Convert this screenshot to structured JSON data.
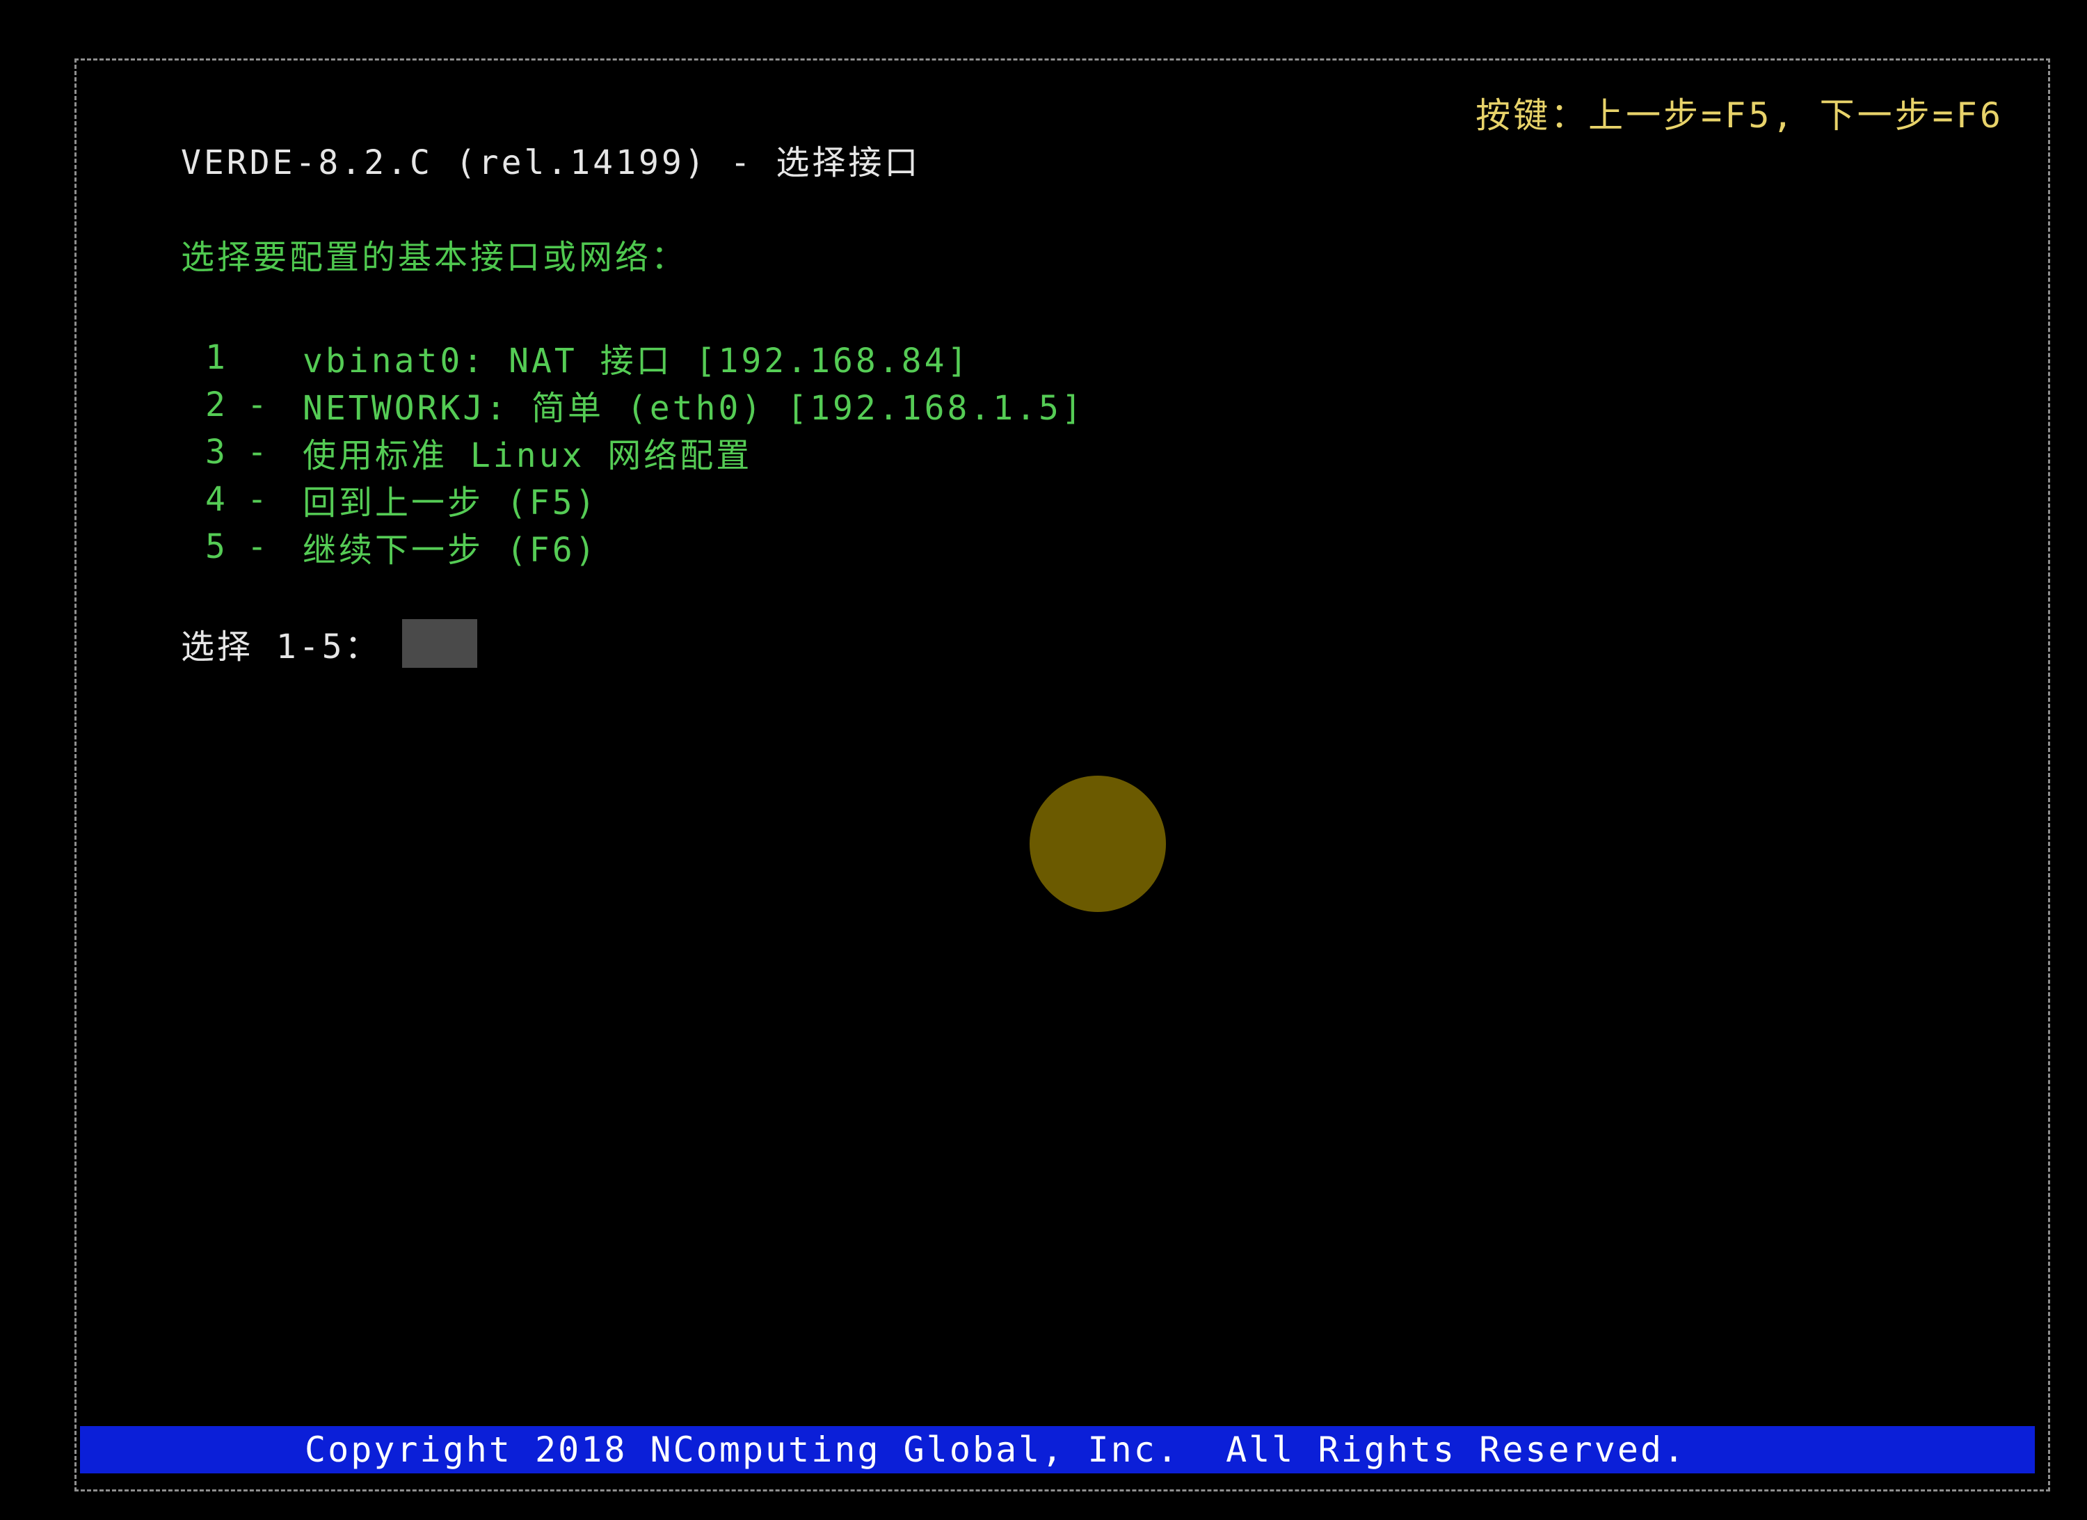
{
  "window": {
    "title": "VERDE-8.2.C (rel.14199) - 选择接口",
    "keys_hint": "按键：上一步=F5, 下一步=F6"
  },
  "prompt": "选择要配置的基本接口或网络：",
  "menu": {
    "items": [
      {
        "num": "1",
        "sep": "",
        "label": "vbinat0: NAT 接口 [192.168.84]"
      },
      {
        "num": "2",
        "sep": "-",
        "label": "NETWORKJ: 简单 (eth0) [192.168.1.5]"
      },
      {
        "num": "3",
        "sep": "-",
        "label": "使用标准 Linux 网络配置"
      },
      {
        "num": "4",
        "sep": "-",
        "label": "回到上一步 (F5)"
      },
      {
        "num": "5",
        "sep": "-",
        "label": "继续下一步 (F6)"
      }
    ]
  },
  "select": {
    "label": "选择 1-5：",
    "value": ""
  },
  "status_bar": {
    "text": "Copyright 2018 NComputing Global, Inc.  All Rights Reserved."
  },
  "colors": {
    "background": "#000000",
    "title_text": "#e6e6e6",
    "prompt_text": "#4fc84f",
    "menu_text": "#55cc55",
    "keys_hint_text": "#e8d36a",
    "status_bar_bg": "#0b1fd8",
    "status_bar_text": "#ffffff",
    "input_bg": "#4a4a4a",
    "cursor_dot": "#6b5a00"
  }
}
